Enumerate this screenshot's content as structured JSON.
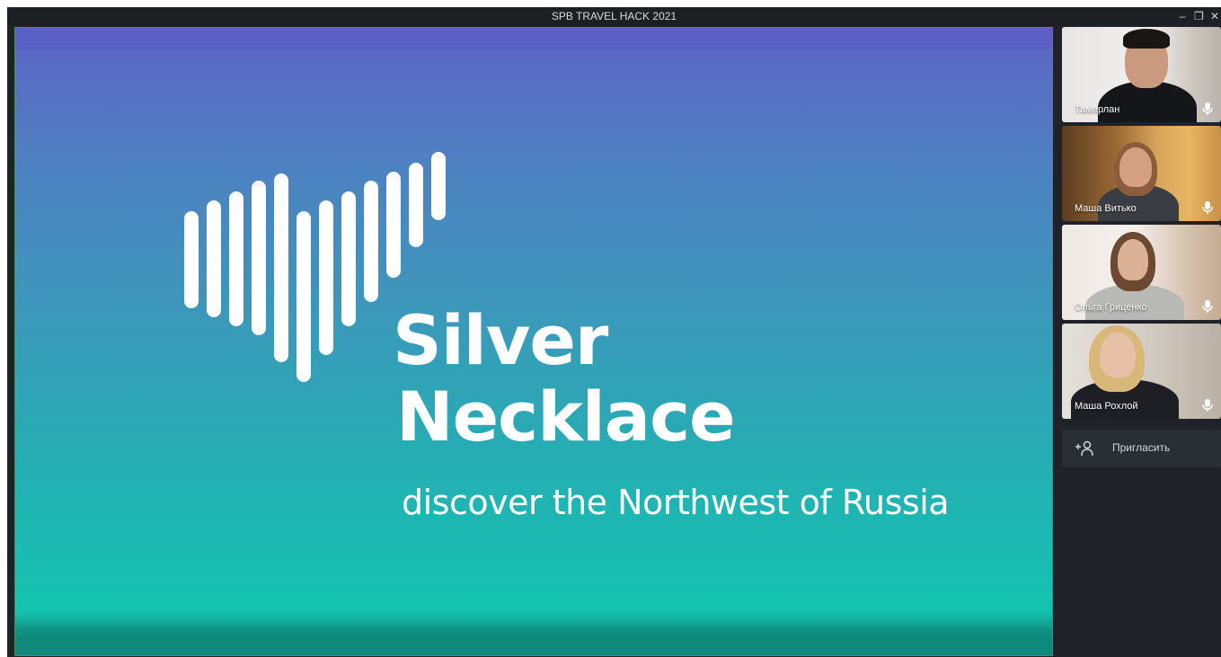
{
  "window": {
    "title": "SPB TRAVEL HACK 2021",
    "controls": [
      "minimize-icon",
      "restore-icon",
      "close-icon"
    ]
  },
  "slide": {
    "brand_line1": "Silver",
    "brand_line2": "Necklace",
    "tagline": "discover the Northwest of Russia"
  },
  "participants": [
    {
      "name": "Тамерлан",
      "active": true
    },
    {
      "name": "Маша Витько",
      "active": false
    },
    {
      "name": "Ольга Гриценко",
      "active": false
    },
    {
      "name": "Маша Рохлой",
      "active": false
    }
  ],
  "invite": {
    "label": "Пригласить"
  },
  "colors": {
    "accent_active_border": "#6fc486",
    "background": "#1f2228"
  }
}
